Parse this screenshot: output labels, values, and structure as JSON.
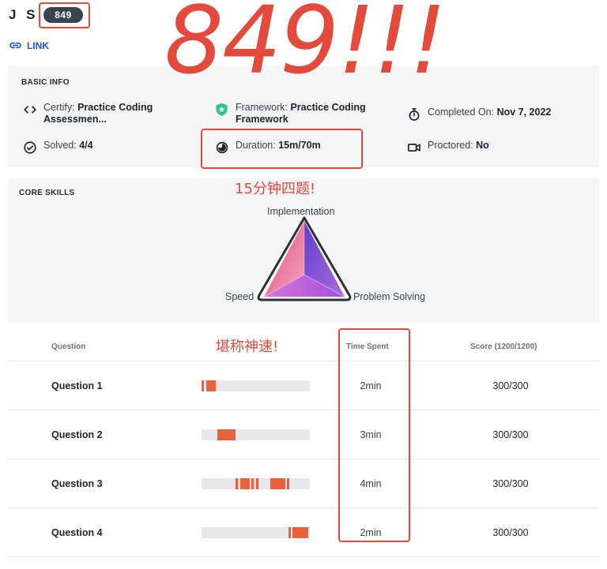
{
  "header": {
    "name": "J S",
    "score_badge": "849"
  },
  "link": {
    "label": "LINK",
    "icon": "link-icon"
  },
  "basic_info": {
    "title": "BASIC INFO",
    "certify": {
      "label": "Certify:",
      "value": "Practice Coding",
      "value2": "Assessmen...",
      "icon": "code-icon"
    },
    "framework": {
      "label": "Framework:",
      "value": "Practice Coding",
      "value2": "Framework",
      "icon": "shield-icon"
    },
    "completed": {
      "label": "Completed On:",
      "value": "Nov 7, 2022",
      "icon": "stopwatch-icon"
    },
    "solved": {
      "label": "Solved:",
      "value": "4/4",
      "icon": "check-circle-icon"
    },
    "duration": {
      "label": "Duration:",
      "value": "15m/70m",
      "icon": "pie-clock-icon"
    },
    "proctored": {
      "label": "Proctored:",
      "value": "No",
      "icon": "video-camera-icon"
    }
  },
  "core_skills": {
    "title": "CORE SKILLS",
    "axes": [
      "Implementation",
      "Speed",
      "Problem Solving"
    ]
  },
  "questions": {
    "headers": {
      "question": "Question",
      "time": "Time Spent",
      "score": "Score (1200/1200)"
    },
    "rows": [
      {
        "name": "Question 1",
        "time": "2min",
        "score": "300/300"
      },
      {
        "name": "Question 2",
        "time": "3min",
        "score": "300/300"
      },
      {
        "name": "Question 3",
        "time": "4min",
        "score": "300/300"
      },
      {
        "name": "Question 4",
        "time": "2min",
        "score": "300/300"
      }
    ]
  },
  "annotations": {
    "big_number": "849!!!",
    "fifteen_min": "15分钟四题!",
    "amazing": "堪称神速!"
  },
  "colors": {
    "annotation_red": "#e44a3c",
    "bar_orange": "#e8603c",
    "link_blue": "#1b53d6",
    "badge_dark": "#39424e"
  }
}
